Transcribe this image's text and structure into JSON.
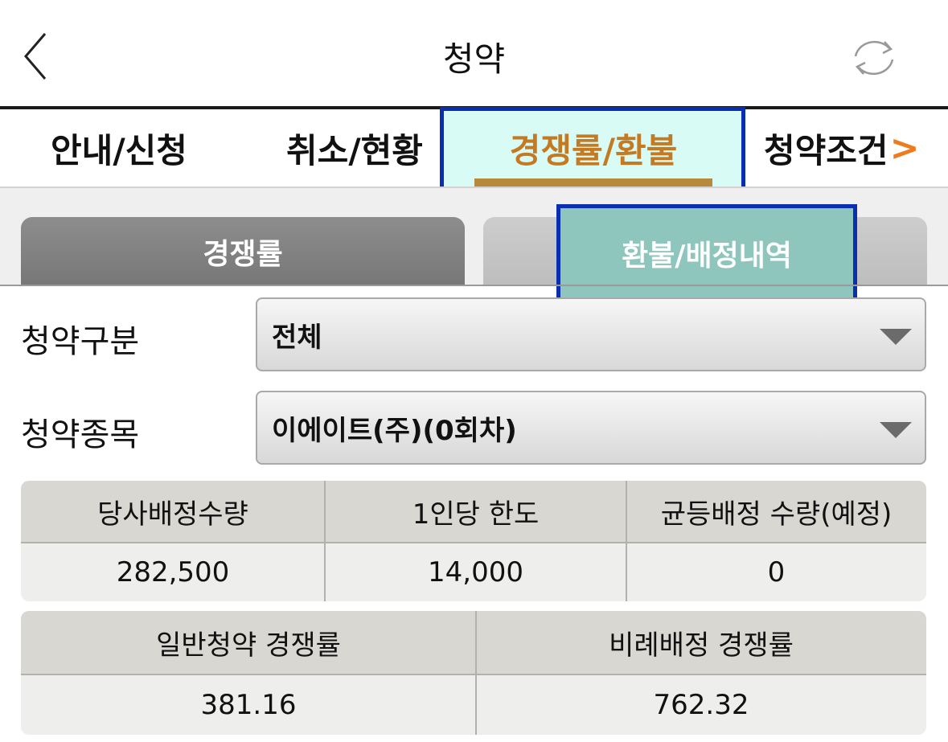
{
  "header": {
    "title": "청약"
  },
  "tabs": [
    {
      "label": "안내/신청"
    },
    {
      "label": "취소/현황"
    },
    {
      "label": "경쟁률/환불"
    },
    {
      "label": "청약조건"
    }
  ],
  "tab_chevron": ">",
  "subtabs": [
    {
      "label": "경쟁률"
    },
    {
      "label": "환불/배정내역"
    }
  ],
  "form": {
    "type_label": "청약구분",
    "type_value": "전체",
    "item_label": "청약종목",
    "item_value": "이에이트(주)(0회차)"
  },
  "table1": {
    "headers": [
      "당사배정수량",
      "1인당 한도",
      "균등배정 수량(예정)"
    ],
    "values": [
      "282,500",
      "14,000",
      "0"
    ]
  },
  "table2": {
    "headers": [
      "일반청약 경쟁률",
      "비례배정 경쟁률"
    ],
    "values": [
      "381.16",
      "762.32"
    ]
  },
  "colors": {
    "accent": "#c47a23",
    "highlight_border": "#0a2eb0",
    "chevron": "#ef7b1f"
  },
  "icons": {
    "back": "chevron-left-icon",
    "refresh": "refresh-icon",
    "dropdown": "triangle-down-icon"
  }
}
